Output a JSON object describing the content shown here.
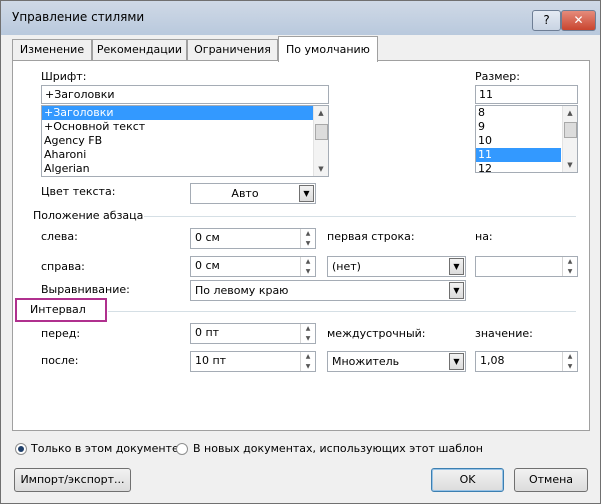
{
  "window": {
    "title": "Управление стилями"
  },
  "tabs": [
    "Изменение",
    "Рекомендации",
    "Ограничения",
    "По умолчанию"
  ],
  "font": {
    "label": "Шрифт:",
    "value": "+Заголовки",
    "list": [
      "+Заголовки",
      "+Основной текст",
      "Agency FB",
      "Aharoni",
      "Algerian"
    ],
    "selected": "+Заголовки"
  },
  "size": {
    "label": "Размер:",
    "value": "11",
    "list": [
      "8",
      "9",
      "10",
      "11",
      "12"
    ],
    "selected": "11"
  },
  "text_color": {
    "label": "Цвет текста:",
    "value": "Авто"
  },
  "paragraph": {
    "header": "Положение абзаца",
    "left_label": "слева:",
    "left_value": "0 см",
    "right_label": "справа:",
    "right_value": "0 см",
    "first_line_label": "первая строка:",
    "first_line_value": "(нет)",
    "by_label": "на:",
    "by_value": "",
    "align_label": "Выравнивание:",
    "align_value": "По левому краю"
  },
  "spacing": {
    "header": "Интервал",
    "before_label": "перед:",
    "before_value": "0 пт",
    "after_label": "после:",
    "after_value": "10 пт",
    "line_label": "междустрочный:",
    "line_value": "Множитель",
    "at_label": "значение:",
    "at_value": "1,08"
  },
  "scope": {
    "this_doc": "Только в этом документе",
    "new_docs": "В новых документах, использующих этот шаблон",
    "selected": "this_doc"
  },
  "buttons": {
    "import_export": "Импорт/экспорт...",
    "ok": "OK",
    "cancel": "Отмена"
  },
  "colors": {
    "highlight": "#b0308e",
    "selection": "#3399ff"
  }
}
